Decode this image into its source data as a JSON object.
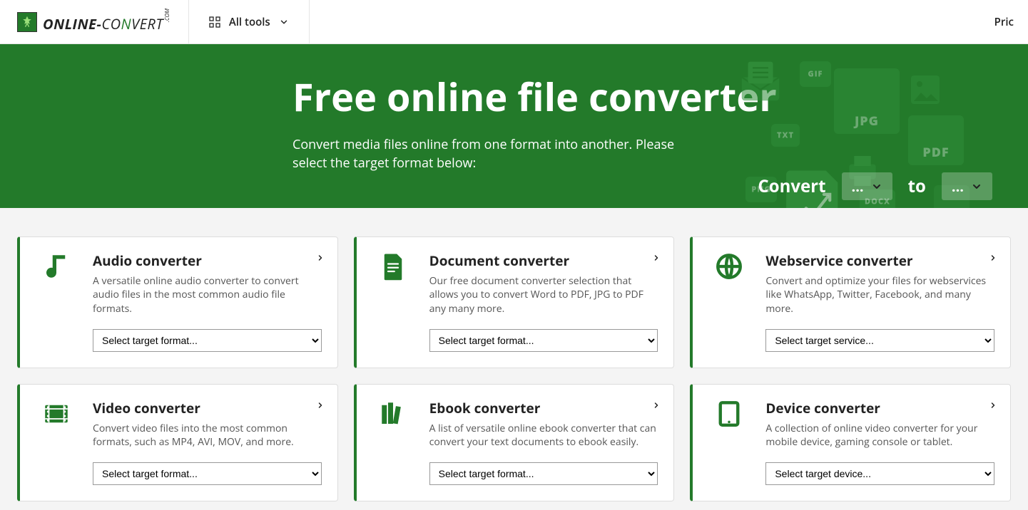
{
  "header": {
    "logo_text_1": "ONLINE-",
    "logo_text_2": "CO",
    "logo_text_n": "N",
    "logo_text_3": "VERT",
    "logo_dotcom": ".COM",
    "alltools_label": "All tools",
    "pricing_label": "Pric"
  },
  "hero": {
    "title": "Free online file converter",
    "subtitle": "Convert media files online from one format into another. Please select the target format below:",
    "convert_label": "Convert",
    "to_label": "to",
    "sel_placeholder": "...",
    "deco_labels": {
      "jpg": "JPG",
      "pdf": "PDF",
      "gif": "GIF",
      "png": "PNG",
      "txt": "TXT",
      "docx": "DOCX"
    }
  },
  "cards": [
    {
      "icon": "music",
      "title": "Audio converter",
      "desc": "A versatile online audio converter to convert audio files in the most common audio file formats.",
      "select_placeholder": "Select target format..."
    },
    {
      "icon": "doc",
      "title": "Document converter",
      "desc": "Our free document converter selection that allows you to convert Word to PDF, JPG to PDF any many more.",
      "select_placeholder": "Select target format..."
    },
    {
      "icon": "globe",
      "title": "Webservice converter",
      "desc": "Convert and optimize your files for webservices like WhatsApp, Twitter, Facebook, and many more.",
      "select_placeholder": "Select target service..."
    },
    {
      "icon": "film",
      "title": "Video converter",
      "desc": "Convert video files into the most common formats, such as MP4, AVI, MOV, and more.",
      "select_placeholder": "Select target format..."
    },
    {
      "icon": "books",
      "title": "Ebook converter",
      "desc": "A list of versatile online ebook converter that can convert your text documents to ebook easily.",
      "select_placeholder": "Select target format..."
    },
    {
      "icon": "tablet",
      "title": "Device converter",
      "desc": "A collection of online video converter for your mobile device, gaming console or tablet.",
      "select_placeholder": "Select target device..."
    }
  ]
}
